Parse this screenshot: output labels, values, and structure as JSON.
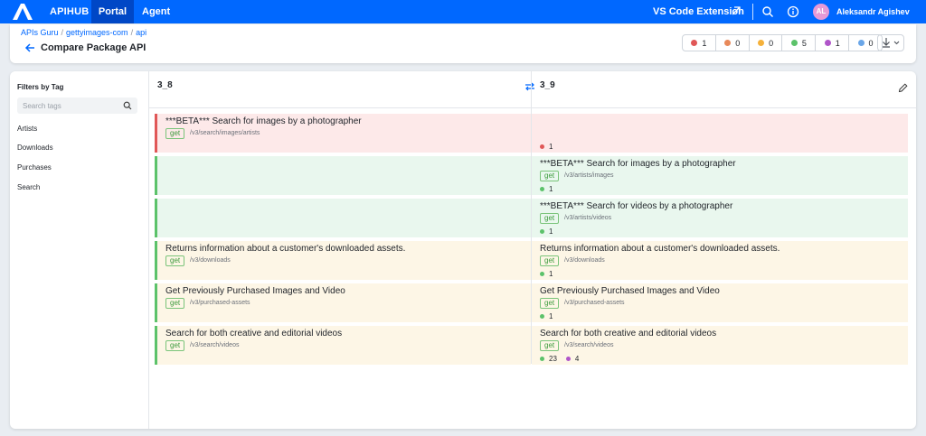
{
  "topbar": {
    "brand": "APIHUB",
    "nav": [
      {
        "label": "Portal"
      },
      {
        "label": "Agent"
      }
    ],
    "vscode_label": "VS Code Extension",
    "user": {
      "initials": "AL",
      "name": "Aleksandr Agishev"
    }
  },
  "header": {
    "breadcrumb": [
      "APIs Guru",
      "gettyimages-com",
      "api"
    ],
    "title": "Compare Package API",
    "counters": [
      {
        "color": "#e05757",
        "value": "1"
      },
      {
        "color": "#e8895a",
        "value": "0"
      },
      {
        "color": "#f5b13a",
        "value": "0"
      },
      {
        "color": "#5cc26a",
        "value": "5"
      },
      {
        "color": "#b055c9",
        "value": "1"
      },
      {
        "color": "#6aa6e8",
        "value": "0"
      }
    ]
  },
  "sidebar": {
    "title": "Filters by Tag",
    "search_placeholder": "Search tags",
    "tags": [
      "Artists",
      "Downloads",
      "Purchases",
      "Search"
    ]
  },
  "compare": {
    "left_version": "3_8",
    "right_version": "3_9",
    "rows": [
      {
        "left": {
          "title": "***BETA*** Search for images by a photographer",
          "method": "get",
          "path": "/v3/search/images/artists"
        },
        "right": {
          "title": "",
          "method": "",
          "path": ""
        },
        "changes": [
          {
            "color": "#e05757",
            "value": "1"
          }
        ]
      },
      {
        "left": {
          "title": "",
          "method": "",
          "path": ""
        },
        "right": {
          "title": "***BETA*** Search for images by a photographer",
          "method": "get",
          "path": "/v3/artists/images"
        },
        "changes": [
          {
            "color": "#5cc26a",
            "value": "1"
          }
        ]
      },
      {
        "left": {
          "title": "",
          "method": "",
          "path": ""
        },
        "right": {
          "title": "***BETA*** Search for videos by a photographer",
          "method": "get",
          "path": "/v3/artists/videos"
        },
        "changes": [
          {
            "color": "#5cc26a",
            "value": "1"
          }
        ]
      },
      {
        "left": {
          "title": "Returns information about a customer's downloaded assets.",
          "method": "get",
          "path": "/v3/downloads"
        },
        "right": {
          "title": "Returns information about a customer's downloaded assets.",
          "method": "get",
          "path": "/v3/downloads"
        },
        "changes": [
          {
            "color": "#5cc26a",
            "value": "1"
          }
        ]
      },
      {
        "left": {
          "title": "Get Previously Purchased Images and Video",
          "method": "get",
          "path": "/v3/purchased-assets"
        },
        "right": {
          "title": "Get Previously Purchased Images and Video",
          "method": "get",
          "path": "/v3/purchased-assets"
        },
        "changes": [
          {
            "color": "#5cc26a",
            "value": "1"
          }
        ]
      },
      {
        "left": {
          "title": "Search for both creative and editorial videos",
          "method": "get",
          "path": "/v3/search/videos"
        },
        "right": {
          "title": "Search for both creative and editorial videos",
          "method": "get",
          "path": "/v3/search/videos"
        },
        "changes": [
          {
            "color": "#5cc26a",
            "value": "23"
          },
          {
            "color": "#b055c9",
            "value": "4"
          }
        ]
      }
    ]
  }
}
